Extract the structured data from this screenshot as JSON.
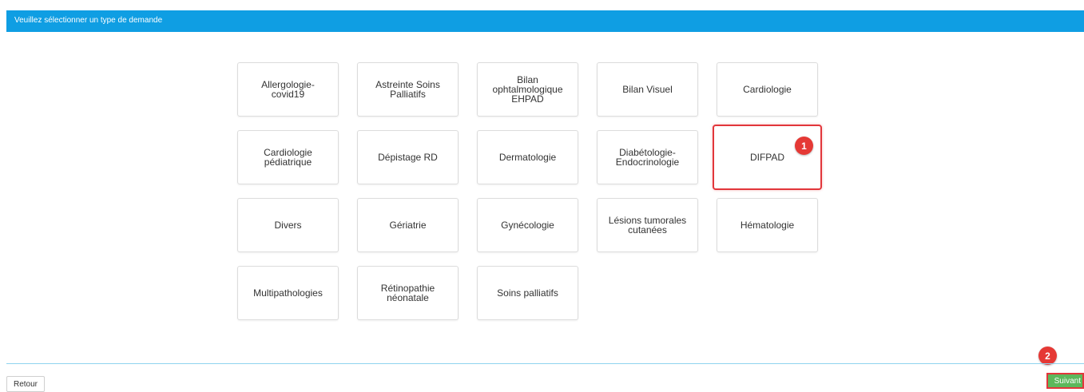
{
  "header": {
    "title": "Veuillez sélectionner un type de demande"
  },
  "colors": {
    "header_bg": "#0f9ee3",
    "highlight": "#e2363b",
    "next_button": "#5cb85c"
  },
  "tiles": [
    {
      "label": "Allergologie-\ncovid19"
    },
    {
      "label": "Astreinte Soins\nPalliatifs"
    },
    {
      "label": "Bilan\nophtalmologique\nEHPAD"
    },
    {
      "label": "Bilan Visuel"
    },
    {
      "label": "Cardiologie"
    },
    {
      "label": "Cardiologie\npédiatrique"
    },
    {
      "label": "Dépistage RD"
    },
    {
      "label": "Dermatologie"
    },
    {
      "label": "Diabétologie-\nEndocrinologie"
    },
    {
      "label": "DIFPAD",
      "selected": true
    },
    {
      "label": "Divers"
    },
    {
      "label": "Gériatrie"
    },
    {
      "label": "Gynécologie"
    },
    {
      "label": "Lésions tumorales\ncutanées"
    },
    {
      "label": "Hématologie"
    },
    {
      "label": "Multipathologies"
    },
    {
      "label": "Rétinopathie\nnéonatale"
    },
    {
      "label": "Soins palliatifs"
    }
  ],
  "annotations": [
    {
      "label": "1"
    },
    {
      "label": "2"
    }
  ],
  "footer": {
    "back_label": "Retour",
    "next_label": "Suivant"
  }
}
